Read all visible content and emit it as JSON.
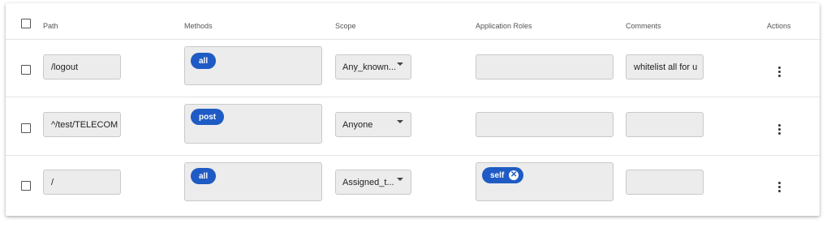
{
  "columns": {
    "path": "Path",
    "methods": "Methods",
    "scope": "Scope",
    "application_roles": "Application Roles",
    "comments": "Comments",
    "actions": "Actions"
  },
  "rows": [
    {
      "path": "/logout",
      "method": "all",
      "scope": "Any_known...",
      "roles": [],
      "comment": "whitelist all for u"
    },
    {
      "path": "^/test/TELECOM",
      "method": "post",
      "scope": "Anyone",
      "roles": [],
      "comment": ""
    },
    {
      "path": "/",
      "method": "all",
      "scope": "Assigned_t...",
      "roles": [
        "self"
      ],
      "comment": ""
    }
  ],
  "icons": {
    "chip_remove": "close-circle-icon",
    "actions": "more-vert-icon",
    "select": "caret-down-icon"
  },
  "colors": {
    "chip": "#1f5bc4",
    "field_bg": "#ececec"
  }
}
